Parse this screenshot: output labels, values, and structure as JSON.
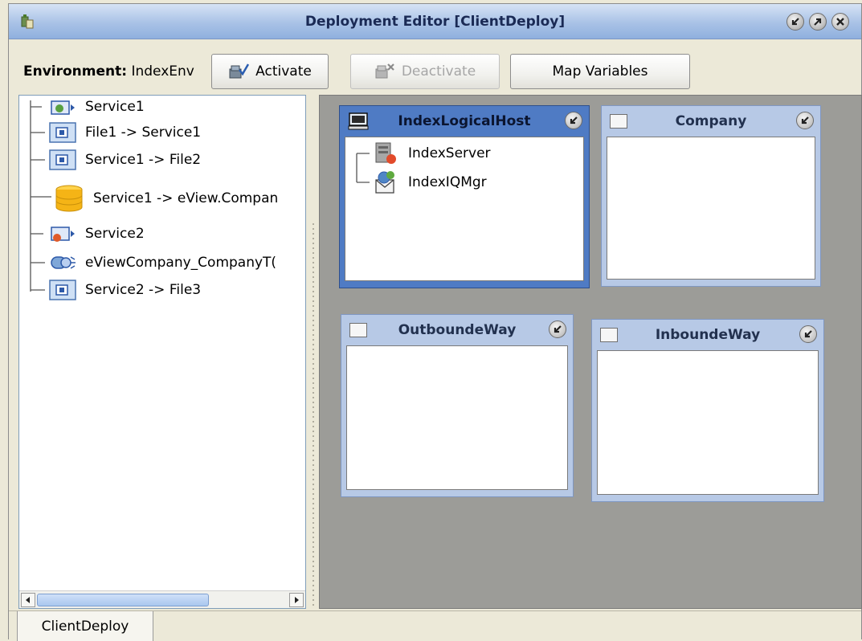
{
  "window": {
    "title": "Deployment Editor [ClientDeploy]",
    "icons": [
      "app-icon",
      "minimize-icon",
      "maximize-icon",
      "close-icon"
    ]
  },
  "toolbar": {
    "environment_label": "Environment:",
    "environment_value": "IndexEnv",
    "activate_label": "Activate",
    "deactivate_label": "Deactivate",
    "map_variables_label": "Map Variables"
  },
  "tree": {
    "items": [
      {
        "label": "Service1",
        "icon": "service-icon"
      },
      {
        "label": "File1 -> Service1",
        "icon": "file-connection-icon"
      },
      {
        "label": "Service1 -> File2",
        "icon": "file-connection-icon"
      },
      {
        "label": "Service1 -> eView.Compan",
        "icon": "database-icon"
      },
      {
        "label": "Service2",
        "icon": "service-icon"
      },
      {
        "label": "eViewCompany_CompanyT(",
        "icon": "connector-icon"
      },
      {
        "label": "Service2 -> File3",
        "icon": "file-connection-icon"
      }
    ]
  },
  "canvas": {
    "hosts": [
      {
        "title": "IndexLogicalHost",
        "selected": true,
        "children": [
          {
            "label": "IndexServer",
            "icon": "server-icon"
          },
          {
            "label": "IndexIQMgr",
            "icon": "message-queue-icon"
          }
        ]
      },
      {
        "title": "Company",
        "selected": false,
        "children": []
      },
      {
        "title": "OutboundeWay",
        "selected": false,
        "children": []
      },
      {
        "title": "InboundeWay",
        "selected": false,
        "children": []
      }
    ]
  },
  "status": {
    "tab_label": "ClientDeploy"
  },
  "colors": {
    "titlebar": "#a9c2e6",
    "selected_host": "#4f7bc4",
    "host": "#b7c9e6",
    "canvas": "#9c9c98"
  }
}
